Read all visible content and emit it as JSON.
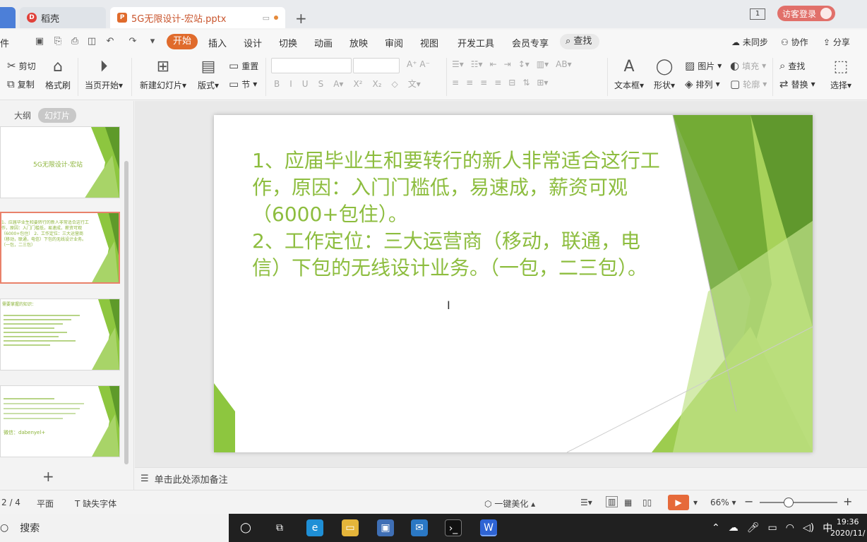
{
  "titlebar": {
    "tabs": [
      {
        "label": "稻壳"
      },
      {
        "label": "5G无限设计-宏站.pptx"
      }
    ],
    "guest_login": "访客登录",
    "page_indicator": "1"
  },
  "menubar": {
    "file_label": "件",
    "items": [
      "开始",
      "插入",
      "设计",
      "切换",
      "动画",
      "放映",
      "审阅",
      "视图",
      "开发工具",
      "会员专享"
    ],
    "search_label": "查找",
    "right": [
      "未同步",
      "协作",
      "分享"
    ]
  },
  "ribbon": {
    "cut": "剪切",
    "copy": "复制",
    "format_painter": "格式刷",
    "play_from_current": "当页开始",
    "new_slide": "新建幻灯片",
    "layout": "版式",
    "section": "节",
    "reset": "重置",
    "text_box": "文本框",
    "shape": "形状",
    "picture": "图片",
    "arrange": "排列",
    "fill": "填充",
    "outline": "轮廓",
    "find": "查找",
    "replace": "替换",
    "select": "选择"
  },
  "left_panel": {
    "tab_outline": "大纲",
    "tab_slides": "幻灯片",
    "thumbnails": [
      {
        "title": "5G无限设计-宏站"
      },
      {
        "text": "1、应届毕业生和要转行的新人非常适合这行工作，原因：入门门槛低，易速成，薪资可观（6000+包住） 2、工作定位：三大运营商（移动，联通，电信）下包的无线设计业务。（一包，二三包）"
      },
      {
        "text": "需要掌握的知识："
      },
      {
        "text": "微信：dabenyel+"
      }
    ]
  },
  "slide": {
    "paragraphs": [
      "1、应届毕业生和要转行的新人非常适合这行工作，原因：入门门槛低，易速成，薪资可观（6000+包住）。",
      "2、工作定位：三大运营商（移动，联通，电信）下包的无线设计业务。（一包，二三包）。"
    ]
  },
  "notes": {
    "placeholder": "单击此处添加备注"
  },
  "statusbar": {
    "page": "2 / 4",
    "theme": "平面",
    "missing_font": "缺失字体",
    "beautify": "一键美化",
    "zoom": "66%"
  },
  "taskbar": {
    "search": "搜索",
    "ime": "中",
    "time": "19:36",
    "date": "2020/11/"
  },
  "colors": {
    "accent": "#e06b2c",
    "slide_text": "#8dbd3f",
    "guest": "#e1706a"
  }
}
